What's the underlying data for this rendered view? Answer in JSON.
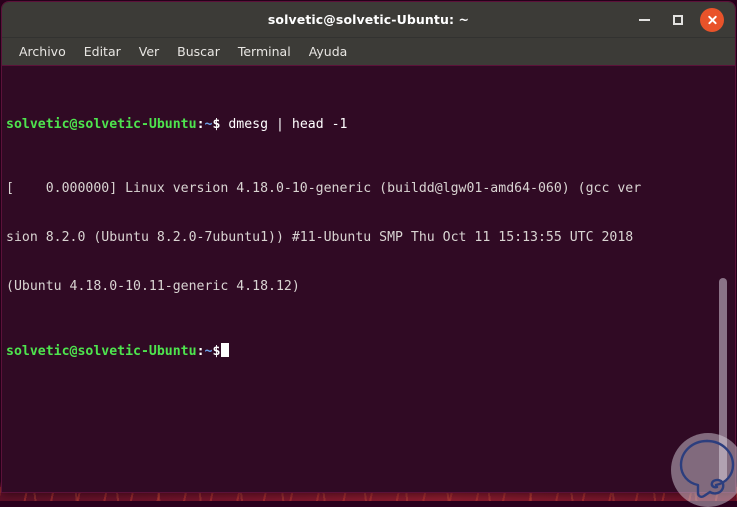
{
  "window": {
    "title": "solvetic@solvetic-Ubuntu: ~",
    "controls": {
      "minimize_label": "Minimizar",
      "maximize_label": "Maximizar",
      "close_label": "Cerrar"
    },
    "colors": {
      "titlebar_bg": "#3c3b37",
      "terminal_bg": "#300a24",
      "window_border": "#5b1139",
      "close_button": "#e9532a",
      "prompt_green": "#4ee44e",
      "prompt_blue": "#6b9fe8",
      "output_text": "#d9d4d2",
      "scrollbar_thumb": "#8a7387"
    }
  },
  "menu": {
    "items": [
      {
        "label": "Archivo"
      },
      {
        "label": "Editar"
      },
      {
        "label": "Ver"
      },
      {
        "label": "Buscar"
      },
      {
        "label": "Terminal"
      },
      {
        "label": "Ayuda"
      }
    ]
  },
  "terminal": {
    "prompt": {
      "user_host": "solvetic@solvetic-Ubuntu",
      "colon": ":",
      "path": "~",
      "sigil": "$"
    },
    "command": " dmesg | head -1",
    "output_lines": [
      "[    0.000000] Linux version 4.18.0-10-generic (buildd@lgw01-amd64-060) (gcc ver",
      "sion 8.2.0 (Ubuntu 8.2.0-7ubuntu1)) #11-Ubuntu SMP Thu Oct 11 15:13:55 UTC 2018",
      "(Ubuntu 4.18.0-10.11-generic 4.18.12)"
    ],
    "cursor_visible": true
  },
  "scrollbar": {
    "orientation": "vertical",
    "position": "right"
  },
  "watermark": {
    "icon": "speech-bubble-logo"
  }
}
